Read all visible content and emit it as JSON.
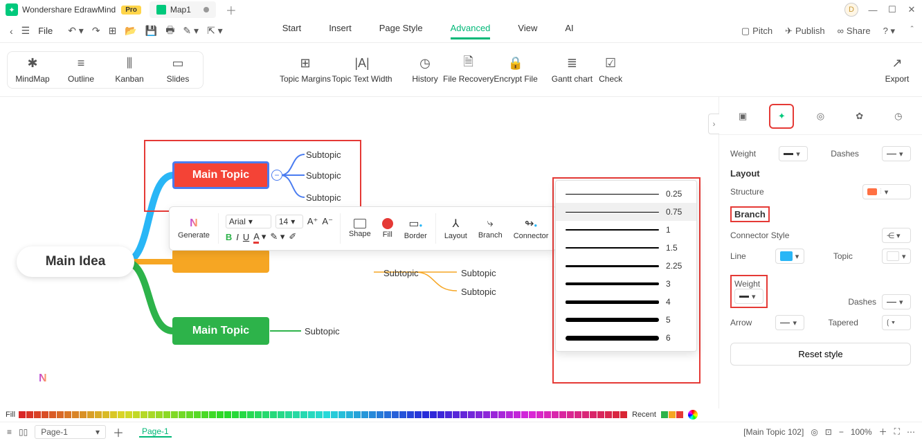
{
  "app": {
    "name": "Wondershare EdrawMind",
    "badge": "Pro",
    "doc_tab": "Map1"
  },
  "user_initial": "D",
  "menu": {
    "file": "File",
    "tabs": [
      "Start",
      "Insert",
      "Page Style",
      "Advanced",
      "View",
      "AI"
    ],
    "active": "Advanced",
    "right": {
      "pitch": "Pitch",
      "publish": "Publish",
      "share": "Share"
    }
  },
  "ribbon": {
    "views": [
      "MindMap",
      "Outline",
      "Kanban",
      "Slides"
    ],
    "tools": [
      "Topic Margins",
      "Topic Text Width",
      "History",
      "File Recovery",
      "Encrypt File",
      "Gantt chart",
      "Check"
    ],
    "export": "Export"
  },
  "mindmap": {
    "main_idea": "Main Idea",
    "topic_red": "Main Topic",
    "topic_green": "Main Topic",
    "subs": [
      "Subtopic",
      "Subtopic",
      "Subtopic"
    ],
    "subs_orange": [
      "Subtopic",
      "Subtopic",
      "Subtopic"
    ],
    "sub_green": "Subtopic"
  },
  "fmt": {
    "generate": "Generate",
    "font": "Arial",
    "size": "14",
    "shape": "Shape",
    "fill": "Fill",
    "border": "Border",
    "layout": "Layout",
    "branch": "Branch",
    "connector": "Connector"
  },
  "weights": [
    "0.25",
    "0.75",
    "1",
    "1.5",
    "2.25",
    "3",
    "4",
    "5",
    "6"
  ],
  "panel": {
    "weight": "Weight",
    "dashes": "Dashes",
    "layout": "Layout",
    "structure": "Structure",
    "branch": "Branch",
    "connector_style": "Connector Style",
    "line": "Line",
    "topic": "Topic",
    "arrow": "Arrow",
    "tapered": "Tapered",
    "reset": "Reset style",
    "line_color": "#29b6f6"
  },
  "colorbar": {
    "fill": "Fill",
    "recent": "Recent"
  },
  "status": {
    "page_sel": "Page-1",
    "page_tab": "Page-1",
    "topic_info": "[Main Topic 102]",
    "zoom": "100%"
  }
}
